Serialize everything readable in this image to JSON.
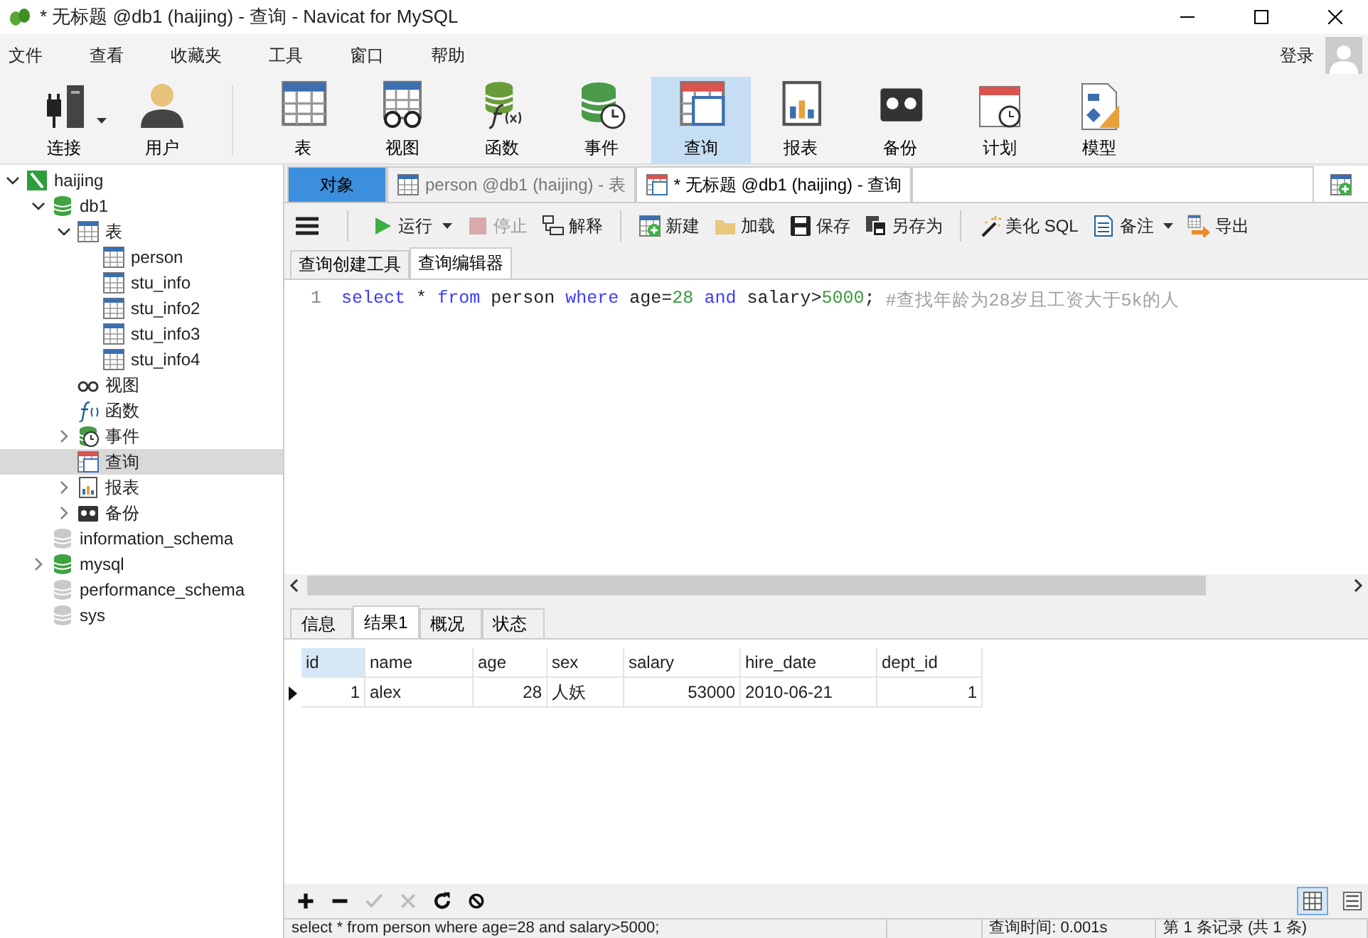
{
  "window": {
    "title": "* 无标题 @db1 (haijing) - 查询 - Navicat for MySQL"
  },
  "menu": [
    "文件",
    "查看",
    "收藏夹",
    "工具",
    "窗口",
    "帮助"
  ],
  "login": "登录",
  "toolbar": [
    {
      "label": "连接",
      "kind": "connect",
      "selected": false
    },
    {
      "label": "用户",
      "kind": "user",
      "selected": false
    },
    {
      "label": "表",
      "kind": "table",
      "selected": false
    },
    {
      "label": "视图",
      "kind": "view",
      "selected": false
    },
    {
      "label": "函数",
      "kind": "function",
      "selected": false
    },
    {
      "label": "事件",
      "kind": "event",
      "selected": false
    },
    {
      "label": "查询",
      "kind": "query",
      "selected": true
    },
    {
      "label": "报表",
      "kind": "report",
      "selected": false
    },
    {
      "label": "备份",
      "kind": "backup",
      "selected": false
    },
    {
      "label": "计划",
      "kind": "schedule",
      "selected": false
    },
    {
      "label": "模型",
      "kind": "model",
      "selected": false
    }
  ],
  "tree": [
    {
      "label": "haijing",
      "kind": "connection",
      "expandable": true,
      "expanded": true,
      "selected": false,
      "children": [
        {
          "label": "db1",
          "kind": "database",
          "expandable": true,
          "expanded": true,
          "selected": false,
          "children": [
            {
              "label": "表",
              "kind": "table",
              "expandable": true,
              "expanded": true,
              "selected": false,
              "children": [
                {
                  "label": "person",
                  "kind": "table",
                  "expandable": false,
                  "expanded": false,
                  "selected": false
                },
                {
                  "label": "stu_info",
                  "kind": "table",
                  "expandable": false,
                  "expanded": false,
                  "selected": false
                },
                {
                  "label": "stu_info2",
                  "kind": "table",
                  "expandable": false,
                  "expanded": false,
                  "selected": false
                },
                {
                  "label": "stu_info3",
                  "kind": "table",
                  "expandable": false,
                  "expanded": false,
                  "selected": false
                },
                {
                  "label": "stu_info4",
                  "kind": "table",
                  "expandable": false,
                  "expanded": false,
                  "selected": false
                }
              ]
            },
            {
              "label": "视图",
              "kind": "view",
              "expandable": false,
              "expanded": false,
              "selected": false
            },
            {
              "label": "函数",
              "kind": "function",
              "expandable": false,
              "expanded": false,
              "selected": false
            },
            {
              "label": "事件",
              "kind": "event",
              "expandable": true,
              "expanded": false,
              "selected": false
            },
            {
              "label": "查询",
              "kind": "query",
              "expandable": false,
              "expanded": false,
              "selected": true
            },
            {
              "label": "报表",
              "kind": "report",
              "expandable": true,
              "expanded": false,
              "selected": false
            },
            {
              "label": "备份",
              "kind": "backup",
              "expandable": true,
              "expanded": false,
              "selected": false
            }
          ]
        },
        {
          "label": "information_schema",
          "kind": "database-closed",
          "expandable": false,
          "expanded": false,
          "selected": false
        },
        {
          "label": "mysql",
          "kind": "database",
          "expandable": true,
          "expanded": false,
          "selected": false
        },
        {
          "label": "performance_schema",
          "kind": "database-closed",
          "expandable": false,
          "expanded": false,
          "selected": false
        },
        {
          "label": "sys",
          "kind": "database-closed",
          "expandable": false,
          "expanded": false,
          "selected": false
        }
      ]
    }
  ],
  "doc_tabs": [
    {
      "label": "对象",
      "kind": "object",
      "selected": false
    },
    {
      "label": "person @db1 (haijing) - 表",
      "kind": "table",
      "selected": false
    },
    {
      "label": "* 无标题 @db1 (haijing) - 查询",
      "kind": "query",
      "selected": true
    }
  ],
  "query_toolbar": [
    {
      "label": "运行",
      "kind": "run",
      "dropdown": true,
      "disabled": false
    },
    {
      "label": "停止",
      "kind": "stop",
      "dropdown": false,
      "disabled": true
    },
    {
      "label": "解释",
      "kind": "explain",
      "dropdown": false,
      "disabled": false
    },
    {
      "label": "新建",
      "kind": "new",
      "dropdown": false,
      "disabled": false
    },
    {
      "label": "加载",
      "kind": "load",
      "dropdown": false,
      "disabled": false
    },
    {
      "label": "保存",
      "kind": "save",
      "dropdown": false,
      "disabled": false
    },
    {
      "label": "另存为",
      "kind": "saveas",
      "dropdown": false,
      "disabled": false
    },
    {
      "label": "美化 SQL",
      "kind": "beautify",
      "dropdown": false,
      "disabled": false
    },
    {
      "label": "备注",
      "kind": "note",
      "dropdown": true,
      "disabled": false
    },
    {
      "label": "导出",
      "kind": "export",
      "dropdown": false,
      "disabled": false
    }
  ],
  "editor_tabs": [
    {
      "label": "查询创建工具",
      "selected": false
    },
    {
      "label": "查询编辑器",
      "selected": true
    }
  ],
  "editor": {
    "line_number": "1",
    "tokens": [
      {
        "text": "select",
        "kind": "keyword"
      },
      {
        "text": "*",
        "kind": "plain"
      },
      {
        "text": "from",
        "kind": "keyword"
      },
      {
        "text": "person",
        "kind": "plain"
      },
      {
        "text": "where",
        "kind": "keyword"
      },
      {
        "text": "age=",
        "kind": "plain",
        "join": true
      },
      {
        "text": "28",
        "kind": "number"
      },
      {
        "text": "and",
        "kind": "keyword"
      },
      {
        "text": "salary>",
        "kind": "plain",
        "join": true
      },
      {
        "text": "5000",
        "kind": "number",
        "join": true
      },
      {
        "text": ";",
        "kind": "plain"
      },
      {
        "text": "#查找年龄为28岁且工资大于5k的人",
        "kind": "comment"
      }
    ]
  },
  "result_tabs": [
    {
      "label": "信息",
      "selected": false
    },
    {
      "label": "结果1",
      "selected": true
    },
    {
      "label": "概况",
      "selected": false
    },
    {
      "label": "状态",
      "selected": false
    }
  ],
  "table": {
    "columns": [
      {
        "label": "id",
        "selected": true,
        "kind": "number"
      },
      {
        "label": "name",
        "selected": false,
        "kind": "text"
      },
      {
        "label": "age",
        "selected": false,
        "kind": "number"
      },
      {
        "label": "sex",
        "selected": false,
        "kind": "text"
      },
      {
        "label": "salary",
        "selected": false,
        "kind": "number"
      },
      {
        "label": "hire_date",
        "selected": false,
        "kind": "text"
      },
      {
        "label": "dept_id",
        "selected": false,
        "kind": "number"
      }
    ],
    "rows": [
      {
        "selected": true,
        "cells": [
          "1",
          "alex",
          "28",
          "人妖",
          "53000",
          "2010-06-21",
          "1"
        ]
      }
    ]
  },
  "grid_actions": [
    {
      "kind": "add",
      "disabled": false
    },
    {
      "kind": "remove",
      "disabled": false
    },
    {
      "kind": "apply",
      "disabled": true
    },
    {
      "kind": "cancel",
      "disabled": true
    },
    {
      "kind": "refresh",
      "disabled": false
    },
    {
      "kind": "stop",
      "disabled": false
    }
  ],
  "view_modes": [
    {
      "kind": "grid",
      "selected": true
    },
    {
      "kind": "form",
      "selected": false
    }
  ],
  "status_bar": {
    "sql": "select * from person where age=28 and salary>5000;",
    "time": "查询时间: 0.001s",
    "record": "第 1 条记录 (共 1 条)"
  }
}
